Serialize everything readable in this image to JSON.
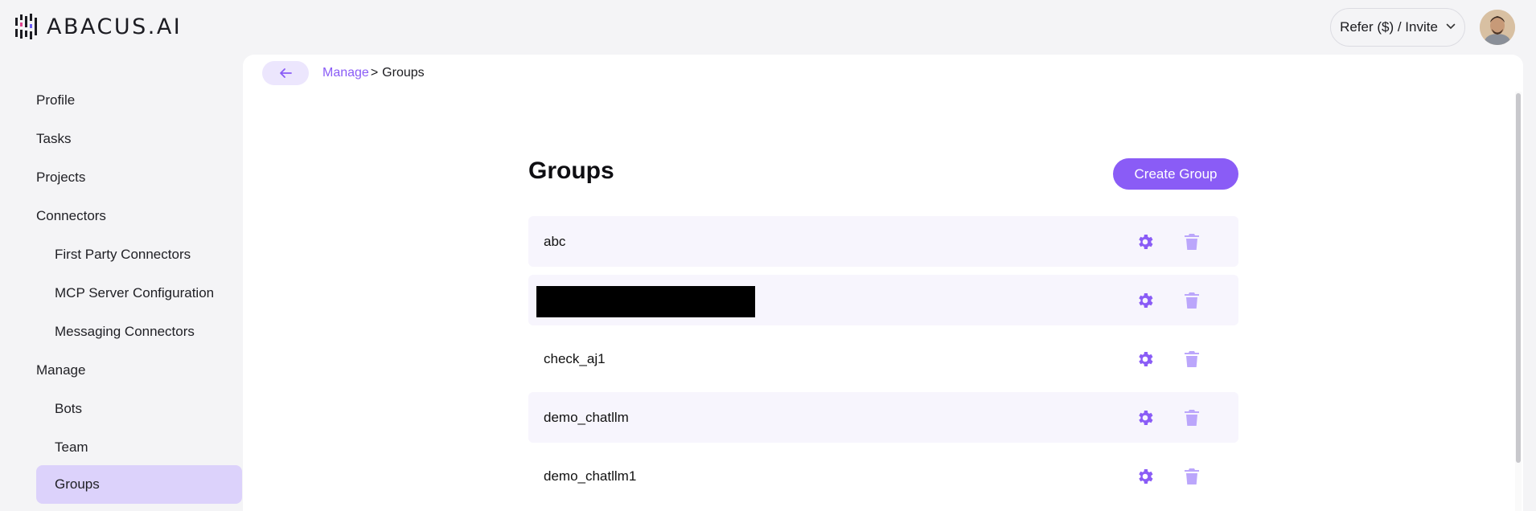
{
  "header": {
    "logo_text_bold": "ABACUS",
    "logo_text_light": ".AI",
    "refer_label": "Refer ($) / Invite",
    "refer_icon": "chevron-down-icon"
  },
  "sidebar": {
    "items": [
      {
        "label": "Profile",
        "level": 1
      },
      {
        "label": "Tasks",
        "level": 1
      },
      {
        "label": "Projects",
        "level": 1
      },
      {
        "label": "Connectors",
        "level": 1
      },
      {
        "label": "First Party Connectors",
        "level": 2
      },
      {
        "label": "MCP Server Configuration",
        "level": 2
      },
      {
        "label": "Messaging Connectors",
        "level": 2
      },
      {
        "label": "Manage",
        "level": 1
      },
      {
        "label": "Bots",
        "level": 2
      },
      {
        "label": "Team",
        "level": 2
      },
      {
        "label": "Groups",
        "level": 2,
        "active": true
      }
    ]
  },
  "breadcrumb": {
    "parent": "Manage",
    "separator": ">",
    "current": "Groups"
  },
  "main": {
    "title": "Groups",
    "create_label": "Create Group",
    "groups": [
      {
        "name": "abc",
        "redacted": false
      },
      {
        "name": "",
        "redacted": true
      },
      {
        "name": "check_aj1",
        "redacted": false
      },
      {
        "name": "demo_chatllm",
        "redacted": false
      },
      {
        "name": "demo_chatllm1",
        "redacted": false
      }
    ]
  },
  "colors": {
    "accent": "#8a5cf6",
    "active_nav_bg": "#dcd2fb",
    "row_shade": "#f7f5fd"
  }
}
